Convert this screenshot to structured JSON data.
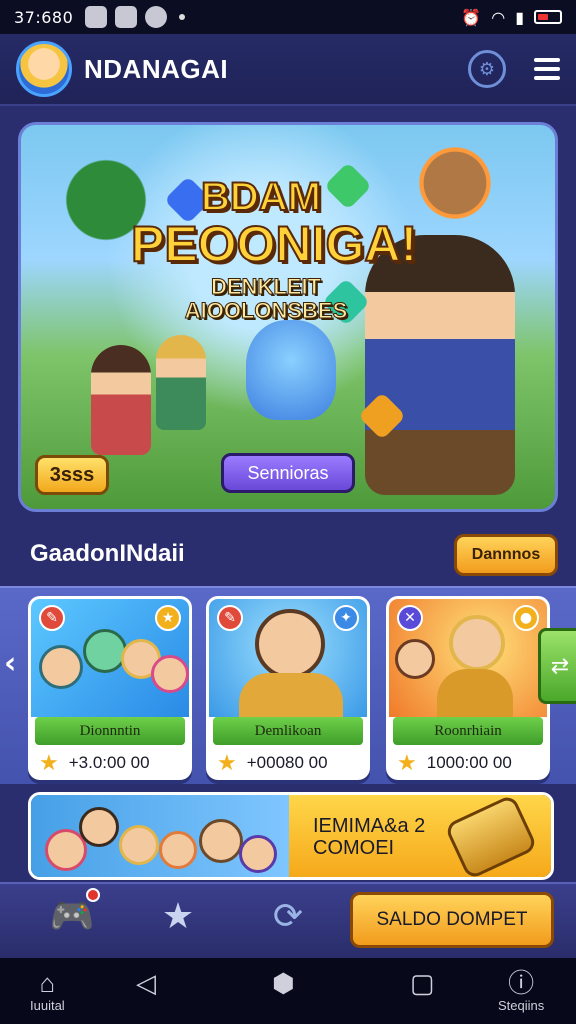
{
  "status_bar": {
    "time": "37:680",
    "icons": [
      "gallery-icon",
      "app-icon",
      "chat-icon",
      "dot-icon",
      "alarm-icon",
      "wifi-icon",
      "signal-icon",
      "battery-icon"
    ]
  },
  "header": {
    "title": "NDANAGAI",
    "icons": [
      "avatar",
      "settings-gear-icon",
      "menu-icon"
    ]
  },
  "hero": {
    "title_line1": "BDAM",
    "title_line2": "PEOONIGA!",
    "subtitle_line1": "DENKLEIT",
    "subtitle_line2": "AIOOLONSBES",
    "button_left": "3sss",
    "button_center": "Sennioras"
  },
  "section": {
    "title": "GaadonINdaii",
    "action_label": "Dannnos"
  },
  "cards": [
    {
      "label": "Dionnntin",
      "price": "+3.0:00 00",
      "colors": {
        "bg": "#3fa0ff",
        "accent": "#ff6ad5"
      }
    },
    {
      "label": "Demlikoan",
      "price": "+00080 00",
      "colors": {
        "bg": "#4fb0ff",
        "accent": "#ffb22a"
      }
    },
    {
      "label": "Roonrhiain",
      "price": "1000:00 00",
      "colors": {
        "bg": "#ff8a3a",
        "accent": "#ffd54a"
      }
    }
  ],
  "promo": {
    "line1": "IEMIMA&a 2",
    "line2": "COMOEI"
  },
  "action_bar": {
    "icons": [
      "game-controller-icon",
      "star-icon",
      "refresh-icon"
    ],
    "button": "SALDO DOMPET"
  },
  "system_nav": {
    "home_label": "Iuuital",
    "settings_label": "Steqiins"
  }
}
